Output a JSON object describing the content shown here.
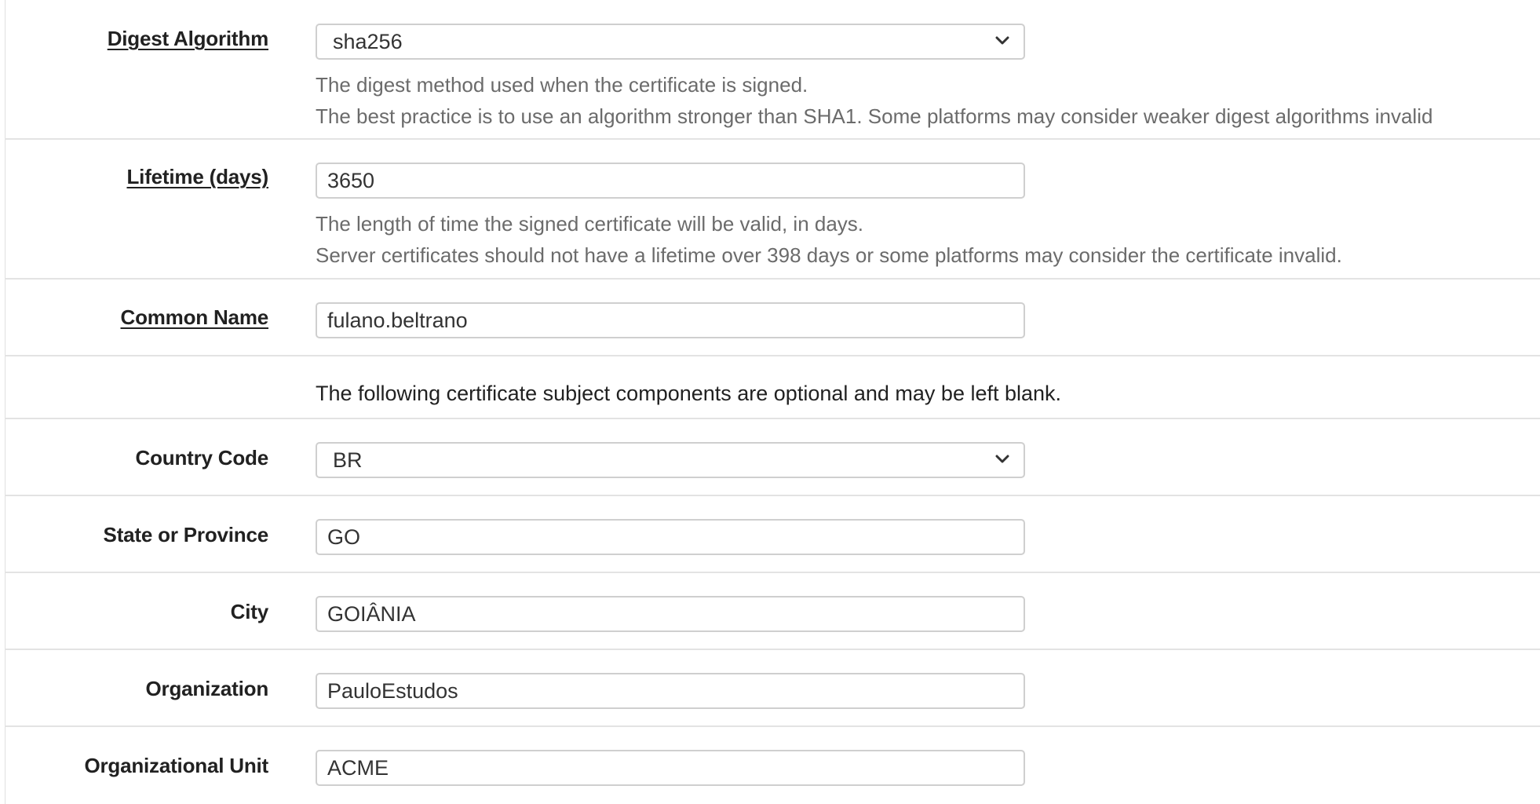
{
  "digest": {
    "label": "Digest Algorithm",
    "value": "sha256",
    "help_line1": "The digest method used when the certificate is signed.",
    "help_line2": "The best practice is to use an algorithm stronger than SHA1. Some platforms may consider weaker digest algorithms invalid"
  },
  "lifetime": {
    "label": "Lifetime (days)",
    "value": "3650",
    "help_line1": "The length of time the signed certificate will be valid, in days.",
    "help_line2": "Server certificates should not have a lifetime over 398 days or some platforms may consider the certificate invalid."
  },
  "common_name": {
    "label": "Common Name",
    "value": "fulano.beltrano"
  },
  "optional_note": "The following certificate subject components are optional and may be left blank.",
  "country": {
    "label": "Country Code",
    "value": "BR"
  },
  "state": {
    "label": "State or Province",
    "value": "GO"
  },
  "city": {
    "label": "City",
    "value": "GOIÂNIA"
  },
  "organization": {
    "label": "Organization",
    "value": "PauloEstudos"
  },
  "org_unit": {
    "label": "Organizational Unit",
    "value": "ACME"
  }
}
